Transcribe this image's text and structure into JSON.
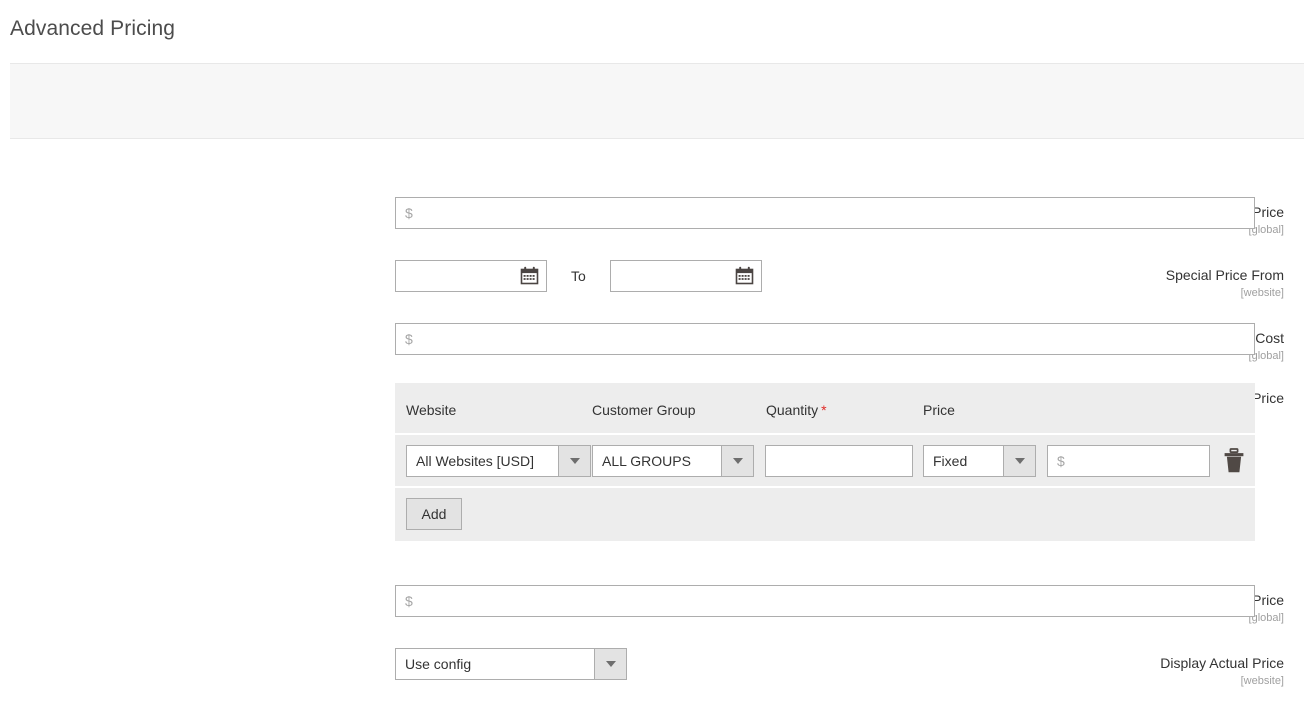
{
  "page": {
    "title": "Advanced Pricing"
  },
  "fields": {
    "special_price": {
      "label": "Special Price",
      "scope": "[global]",
      "placeholder": "$",
      "value": ""
    },
    "special_price_from": {
      "label": "Special Price From",
      "scope": "[website]",
      "from_value": "",
      "from_placeholder": "",
      "to_label": "To",
      "to_value": "",
      "to_placeholder": "",
      "calendar_icon": "calendar-icon"
    },
    "cost": {
      "label": "Cost",
      "scope": "[global]",
      "placeholder": "$",
      "value": ""
    },
    "customer_group_price": {
      "label": "Customer Group Price",
      "scope": "",
      "columns": [
        "Website",
        "Customer Group",
        "Quantity",
        "Price"
      ],
      "quantity_required_marker": "*",
      "rows": [
        {
          "website": "All Websites [USD]",
          "customer_group": "ALL GROUPS",
          "quantity": "",
          "quantity_placeholder": "",
          "price_type": "Fixed",
          "price": "",
          "price_placeholder": "$",
          "delete_icon": "trash-icon"
        }
      ],
      "add_label": "Add"
    },
    "minimum_advertised_price": {
      "label": "Minimum Advertised Price",
      "scope": "[global]",
      "placeholder": "$",
      "value": ""
    },
    "display_actual_price": {
      "label": "Display Actual Price",
      "scope": "[website]",
      "value": "Use config"
    }
  },
  "colors": {
    "required_star": "#e02b27",
    "panel_bg": "#f7f7f7",
    "table_bg": "#ededed",
    "border": "#adadad"
  }
}
